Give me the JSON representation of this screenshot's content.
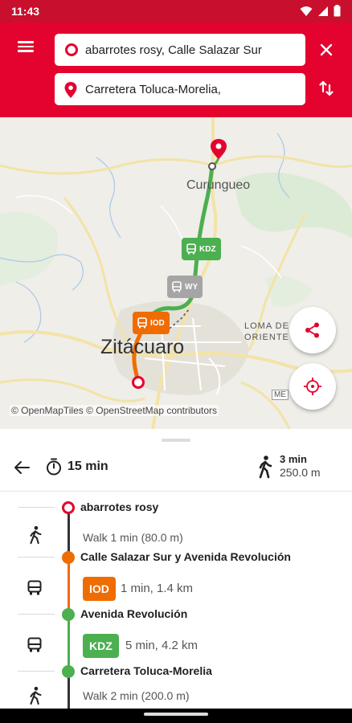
{
  "status_bar": {
    "time": "11:43"
  },
  "search": {
    "origin_value": "abarrotes rosy, Calle Salazar Sur",
    "destination_value": "Carretera Toluca-Morelia,"
  },
  "map": {
    "labels": {
      "town_north": "Curungueo",
      "city": "Zitácuaro",
      "loma": "LOMA DE",
      "oriente": "ORIENTE",
      "highway": "ME"
    },
    "route_badges": {
      "kdz": "KDZ",
      "wy": "WY",
      "iod": "IOD"
    },
    "attribution": "© OpenMapTiles © OpenStreetMap contributors"
  },
  "trip": {
    "duration": "15 min",
    "walk_time": "3 min",
    "walk_distance": "250.0 m"
  },
  "itinerary": {
    "stops": [
      {
        "name": "abarrotes rosy"
      },
      {
        "name": "Calle Salazar Sur y Avenida Revolución"
      },
      {
        "name": "Avenida Revolución"
      },
      {
        "name": "Carretera Toluca-Morelia"
      }
    ],
    "legs": [
      {
        "mode": "walk",
        "text": "Walk 1 min (80.0 m)"
      },
      {
        "mode": "bus",
        "route": "IOD",
        "text": "1 min, 1.4 km"
      },
      {
        "mode": "bus",
        "route": "KDZ",
        "text": "5 min, 4.2 km"
      },
      {
        "mode": "walk",
        "text": "Walk 2 min (200.0 m)"
      }
    ]
  },
  "colors": {
    "brand_red": "#e4032e",
    "status_red": "#c8102e",
    "route_green": "#4caf50",
    "route_orange": "#ef6c00",
    "route_grey": "#9e9e9e"
  }
}
